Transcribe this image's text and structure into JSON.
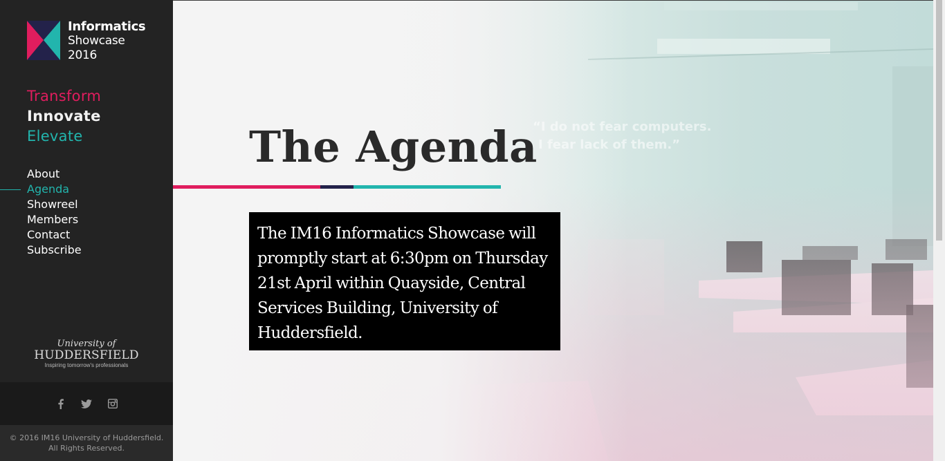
{
  "brand": {
    "line1": "Informatics",
    "line2": "Showcase",
    "line3": "2016",
    "colors": {
      "pink": "#e01d5e",
      "navy": "#23224a",
      "teal": "#22b5ad"
    }
  },
  "tagline": {
    "t1": "Transform",
    "t2": "Innovate",
    "t3": "Elevate"
  },
  "nav": {
    "items": [
      {
        "label": "About"
      },
      {
        "label": "Agenda",
        "active": true
      },
      {
        "label": "Showreel"
      },
      {
        "label": "Members"
      },
      {
        "label": "Contact"
      },
      {
        "label": "Subscribe"
      }
    ]
  },
  "university": {
    "line1": "University of",
    "line2": "HUDDERSFIELD",
    "line3": "Inspiring tomorrow's professionals"
  },
  "social": {
    "icons": [
      "facebook-icon",
      "twitter-icon",
      "instagram-icon"
    ]
  },
  "footer": {
    "line1": "© 2016 IM16 University of Huddersfield.",
    "line2": "All Rights Reserved."
  },
  "main": {
    "title": "The Agenda",
    "body": "The IM16 Informatics Showcase will promptly start at 6:30pm on Thursday 21st April within Quayside, Central Services Building, University of Huddersfield.",
    "quote_line1": "“I do not fear computers.",
    "quote_line2": "I fear lack of them.”"
  }
}
